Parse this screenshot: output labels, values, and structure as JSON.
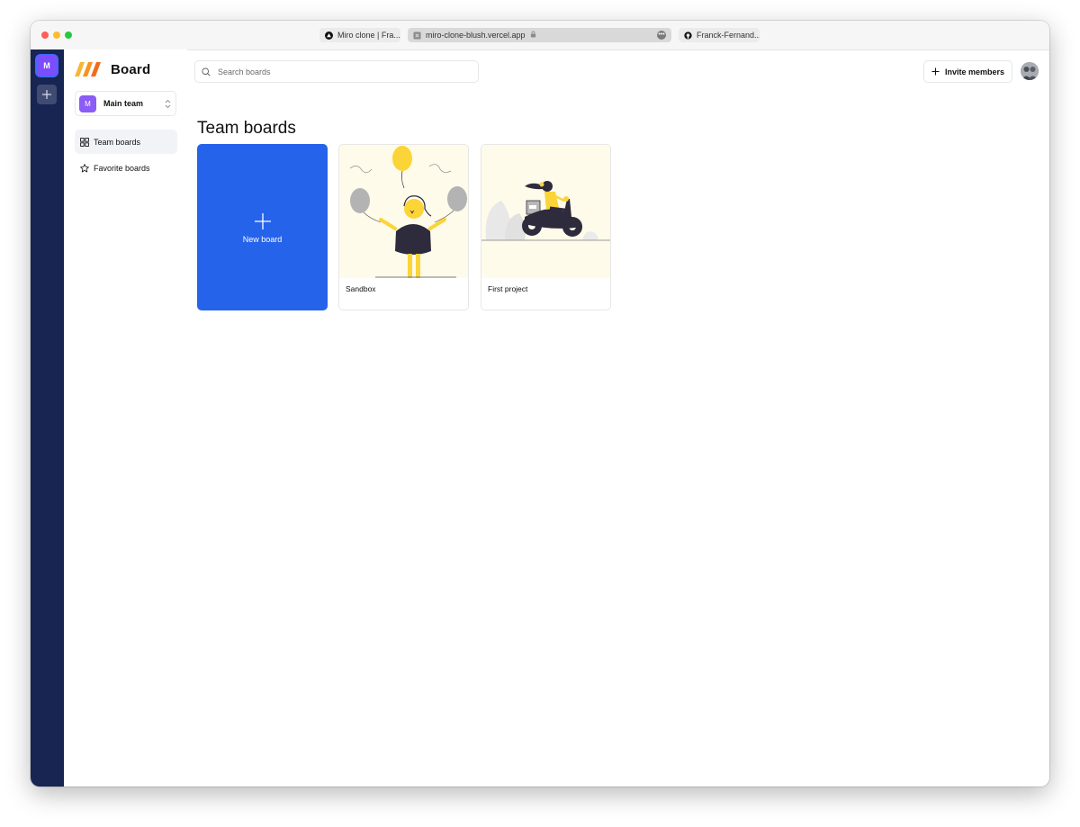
{
  "browser": {
    "tabs": [
      {
        "label": "Miro clone | Fra..."
      },
      {
        "label": "miro-clone-blush.vercel.app"
      },
      {
        "label": "Franck-Fernand..."
      }
    ]
  },
  "org_rail": {
    "current_org_initial": "M"
  },
  "sidebar": {
    "logo_text": "Board",
    "team": {
      "initial": "M",
      "name": "Main team"
    },
    "nav": [
      {
        "label": "Team boards",
        "active": true,
        "icon": "dashboard-icon"
      },
      {
        "label": "Favorite boards",
        "active": false,
        "icon": "star-icon"
      }
    ]
  },
  "header": {
    "search_placeholder": "Search boards",
    "invite_label": "Invite members"
  },
  "main": {
    "title": "Team boards",
    "new_board_label": "New board",
    "boards": [
      {
        "title": "Sandbox"
      },
      {
        "title": "First project"
      }
    ]
  },
  "colors": {
    "rail_bg": "#182451",
    "primary": "#2563eb",
    "org_avatar": "#7c4dff",
    "thumb_bg": "#fefbea",
    "illustration_yellow": "#fbd437",
    "illustration_dark": "#2e2b3c"
  }
}
